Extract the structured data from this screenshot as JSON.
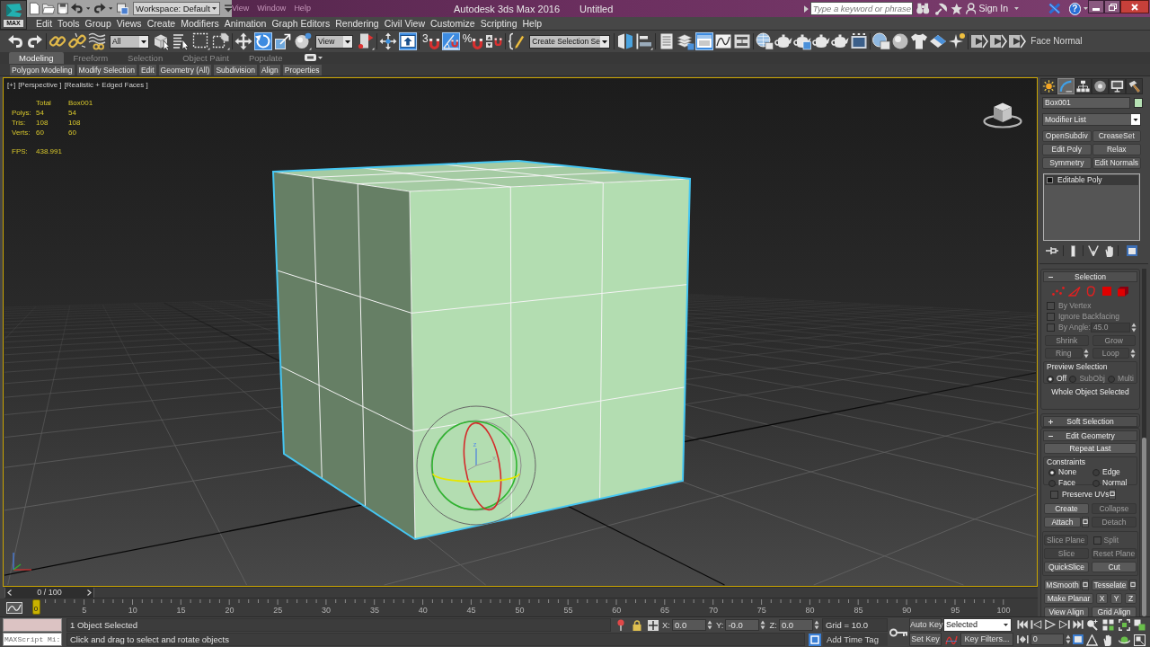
{
  "title_bar": {
    "app_label": "MAX",
    "workspace": "Workspace: Default",
    "hidden_menu": [
      "View",
      "Window",
      "Help"
    ],
    "title": "Autodesk 3ds Max 2016",
    "document": "Untitled",
    "search": {
      "placeholder": "Type a keyword or phrase"
    },
    "sign_in": "Sign In",
    "help": "?"
  },
  "menu_bar": [
    "Edit",
    "Tools",
    "Group",
    "Views",
    "Create",
    "Modifiers",
    "Animation",
    "Graph Editors",
    "Rendering",
    "Civil View",
    "Customize",
    "Scripting",
    "Help"
  ],
  "main_toolbar": [
    [
      {
        "kind": "icon",
        "on": false
      },
      {
        "kind": "icon",
        "on": false
      }
    ],
    [
      {
        "kind": "icon",
        "on": false
      },
      {
        "kind": "icon",
        "on": false
      },
      {
        "kind": "icon",
        "on": false
      },
      {
        "kind": "dropdown",
        "value": "All"
      },
      {
        "kind": "icon",
        "on": false
      },
      {
        "kind": "icon",
        "on": false
      },
      {
        "kind": "icon",
        "on": false
      },
      {
        "kind": "icon",
        "on": false
      }
    ],
    [
      {
        "kind": "icon",
        "on": false
      },
      {
        "kind": "icon",
        "on": true
      },
      {
        "kind": "icon",
        "on": false
      },
      {
        "kind": "icon",
        "on": false
      },
      {
        "kind": "dropdown",
        "value": "View"
      },
      {
        "kind": "icon",
        "on": false
      }
    ],
    [
      {
        "kind": "icon",
        "on": false
      },
      {
        "kind": "icon",
        "on": true
      }
    ],
    [
      {
        "kind": "snap",
        "glyph": "3",
        "on": false
      },
      {
        "kind": "icon",
        "on": true
      },
      {
        "kind": "snap",
        "glyph": "%",
        "on": false
      },
      {
        "kind": "icon",
        "on": false
      }
    ],
    [
      {
        "kind": "icon",
        "on": false
      },
      {
        "kind": "dropdown",
        "value": "Create Selection Se"
      }
    ],
    [
      {
        "kind": "icon",
        "on": false
      },
      {
        "kind": "icon",
        "on": false
      }
    ],
    [
      {
        "kind": "icon",
        "on": false
      },
      {
        "kind": "icon",
        "on": false
      },
      {
        "kind": "icon",
        "on": true
      },
      {
        "kind": "icon",
        "on": false
      },
      {
        "kind": "icon",
        "on": false
      }
    ],
    [
      {
        "kind": "icon",
        "on": false
      },
      {
        "kind": "icon",
        "on": false
      },
      {
        "kind": "icon",
        "on": false
      },
      {
        "kind": "icon",
        "on": false
      },
      {
        "kind": "icon",
        "on": false
      },
      {
        "kind": "icon",
        "on": false
      }
    ],
    [
      {
        "kind": "icon",
        "on": false
      },
      {
        "kind": "icon",
        "on": false
      },
      {
        "kind": "icon",
        "on": false
      },
      {
        "kind": "icon",
        "on": false
      },
      {
        "kind": "icon",
        "on": false
      }
    ],
    [
      {
        "kind": "icon",
        "on": false
      },
      {
        "kind": "icon",
        "on": false
      },
      {
        "kind": "icon",
        "on": false
      },
      {
        "kind": "label",
        "text": "Face Normal"
      }
    ]
  ],
  "ribbon": {
    "tabs": [
      {
        "label": "Modeling",
        "selected": true
      },
      {
        "label": "Freeform",
        "selected": false
      },
      {
        "label": "Selection",
        "selected": false
      },
      {
        "label": "Object Paint",
        "selected": false
      },
      {
        "label": "Populate",
        "selected": false
      }
    ],
    "panels": [
      "Polygon Modeling",
      "Modify Selection",
      "Edit",
      "Geometry (All)",
      "Subdivision",
      "Align",
      "Properties"
    ]
  },
  "viewport": {
    "active": true,
    "labels": [
      "[+]",
      "[Perspective ]",
      "[Realistic + Edged Faces ]"
    ],
    "stats": {
      "columns": [
        "Total",
        "Box001"
      ],
      "rows": [
        {
          "label": "Polys:",
          "values": [
            "54",
            "54"
          ]
        },
        {
          "label": "Tris:",
          "values": [
            "108",
            "108"
          ]
        },
        {
          "label": "Verts:",
          "values": [
            "60",
            "60"
          ]
        }
      ],
      "fps": {
        "label": "FPS:",
        "value": "438.991"
      }
    },
    "object": {
      "selected": true
    },
    "gizmo": {
      "axes": [
        "z",
        "x"
      ]
    }
  },
  "command_panel": {
    "tabs": [
      {
        "selected": false
      },
      {
        "selected": true
      },
      {
        "selected": false
      },
      {
        "selected": false
      },
      {
        "selected": false
      },
      {
        "selected": false
      }
    ],
    "object": {
      "name": "Box001",
      "color": "#b7e2b5"
    },
    "modifier_list": "Modifier List",
    "modifier_buttons": [
      "OpenSubdiv",
      "CreaseSet",
      "Edit Poly",
      "Relax",
      "Symmetry",
      "Edit Normals"
    ],
    "stack": [
      {
        "label": "Editable Poly",
        "selected": true
      }
    ],
    "selection": {
      "title": "Selection",
      "expanded": true,
      "levels": [
        {
          "selected": false
        },
        {
          "selected": false
        },
        {
          "selected": false
        },
        {
          "selected": false
        },
        {
          "selected": false
        }
      ],
      "options": [
        {
          "label": "By Vertex",
          "checked": false,
          "disabled": true
        },
        {
          "label": "Ignore Backfacing",
          "checked": false,
          "disabled": true
        },
        {
          "label": "By Angle:",
          "checked": false,
          "disabled": true,
          "value": "45.0"
        }
      ],
      "buttons": [
        {
          "label": "Shrink",
          "disabled": true
        },
        {
          "label": "Grow",
          "disabled": true
        },
        {
          "label": "Ring",
          "disabled": true
        },
        {
          "label": "Loop",
          "disabled": true
        }
      ],
      "preview": {
        "title": "Preview Selection",
        "options": [
          {
            "label": "Off",
            "selected": true,
            "disabled": false
          },
          {
            "label": "SubObj",
            "selected": false,
            "disabled": true
          },
          {
            "label": "Multi",
            "selected": false,
            "disabled": true
          }
        ]
      },
      "status": "Whole Object Selected"
    },
    "soft_selection": {
      "title": "Soft Selection",
      "expanded": false
    },
    "edit_geometry": {
      "title": "Edit Geometry",
      "expanded": true,
      "repeat_last": "Repeat Last",
      "constraints": {
        "title": "Constraints",
        "options": [
          {
            "label": "None",
            "selected": true
          },
          {
            "label": "Edge",
            "selected": false
          },
          {
            "label": "Face",
            "selected": false
          },
          {
            "label": "Normal",
            "selected": false
          }
        ]
      },
      "preserve_uvs": {
        "label": "Preserve UVs",
        "checked": false,
        "settings": true
      },
      "sections": [
        {
          "framed": false,
          "rows": [
            [
              {
                "kind": "button",
                "label": "Create",
                "disabled": false,
                "settings": false
              },
              {
                "kind": "button",
                "label": "Collapse",
                "disabled": true,
                "settings": false
              }
            ],
            [
              {
                "kind": "button",
                "label": "Attach",
                "disabled": false,
                "settings": true
              },
              {
                "kind": "button",
                "label": "Detach",
                "disabled": true,
                "settings": false
              }
            ]
          ]
        },
        {
          "framed": true,
          "rows": [
            [
              {
                "kind": "button",
                "label": "Slice Plane",
                "disabled": true,
                "settings": false
              },
              {
                "kind": "checkbox",
                "label": "Split",
                "checked": false,
                "disabled": true
              }
            ],
            [
              {
                "kind": "button",
                "label": "Slice",
                "disabled": true,
                "settings": false
              },
              {
                "kind": "button",
                "label": "Reset Plane",
                "disabled": true,
                "settings": false
              }
            ],
            [
              {
                "kind": "button",
                "label": "QuickSlice",
                "disabled": false,
                "settings": false
              },
              {
                "kind": "button",
                "label": "Cut",
                "disabled": false,
                "settings": false
              }
            ]
          ]
        },
        {
          "framed": false,
          "rows": [
            [
              {
                "kind": "button",
                "label": "MSmooth",
                "disabled": false,
                "settings": true
              },
              {
                "kind": "button",
                "label": "Tesselate",
                "disabled": false,
                "settings": true
              }
            ],
            [
              {
                "kind": "button",
                "label": "Make Planar",
                "disabled": false,
                "settings": false
              },
              {
                "kind": "button",
                "label": "X",
                "disabled": false,
                "settings": false
              },
              {
                "kind": "button",
                "label": "Y",
                "disabled": false,
                "settings": false
              },
              {
                "kind": "button",
                "label": "Z",
                "disabled": false,
                "settings": false
              }
            ],
            [
              {
                "kind": "button",
                "label": "View Align",
                "disabled": false,
                "settings": false
              },
              {
                "kind": "button",
                "label": "Grid Align",
                "disabled": false,
                "settings": false
              }
            ]
          ]
        }
      ]
    }
  },
  "time_slider": {
    "label": "0 / 100",
    "level": 0
  },
  "track_bar": {
    "frame": "0",
    "labels": [
      "5",
      "10",
      "15",
      "20",
      "25",
      "30",
      "35",
      "40",
      "45",
      "50",
      "55",
      "60",
      "65",
      "70",
      "75",
      "80",
      "85",
      "90",
      "95",
      "100"
    ]
  },
  "status_bar": {
    "listener": "MAXScript Mi:",
    "selection": "1 Object Selected",
    "prompt": "Click and drag to select and rotate objects",
    "coords": [
      {
        "axis": "X:",
        "value": "0.0"
      },
      {
        "axis": "Y:",
        "value": "-0.0"
      },
      {
        "axis": "Z:",
        "value": "0.0"
      }
    ],
    "grid": "Grid = 10.0",
    "time_tag": "Add Time Tag",
    "auto_key": {
      "label": "Auto Key",
      "on": false
    },
    "key_mode": "Selected",
    "set_key": "Set Key",
    "key_filters": "Key Filters...",
    "frame": "0"
  }
}
